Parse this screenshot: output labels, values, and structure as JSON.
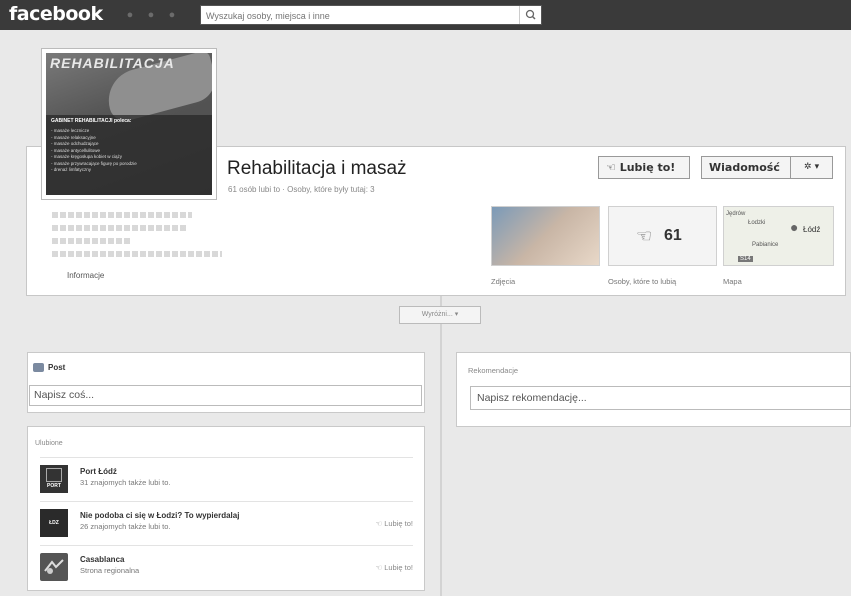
{
  "topbar": {
    "logo": "facebook",
    "search_placeholder": "Wyszukaj osoby, miejsca i inne"
  },
  "profile": {
    "cover_title": "REHABILITACJA",
    "box_header": "GABINET REHABILITACJI poleca:",
    "box_lines": [
      "- masaże lecznicze",
      "- masaże relaksacyjne",
      "- masaże odchudzające",
      "- masaże antycellulitowe",
      "- masaże kręgosłupa kobiet w ciąży",
      "- masaże przywracające figurę po porodzie",
      "- drenaż limfatyczny"
    ],
    "name": "Rehabilitacja i masaż",
    "subtitle": "61 osób lubi to · Osoby, które były tutaj: 3"
  },
  "actions": {
    "like": "Lubię to!",
    "message": "Wiadomość",
    "gear": "✲ ▾"
  },
  "info": {
    "label": "Informacje"
  },
  "tiles": {
    "photos_label": "Zdjęcia",
    "likes_count": "61",
    "likes_label": "Osoby, które to lubią",
    "map_label": "Mapa",
    "map_texts": [
      "Jędrów",
      "Łodzki",
      "Łódź",
      "Pabianice",
      "S14"
    ]
  },
  "timeline": {
    "highlight": "Wyróżni... ▾",
    "post_header": "Post",
    "post_placeholder": "Napisz coś...",
    "rec_header": "Rekomendacje",
    "rec_placeholder": "Napisz rekomendację..."
  },
  "favorites": {
    "header": "Ulubione",
    "items": [
      {
        "name": "Port Łódź",
        "sub": "31 znajomych także lubi to.",
        "thumb": "PORT",
        "like": ""
      },
      {
        "name": "Nie podoba ci się w Łodzi? To wypierdalaj",
        "sub": "26 znajomych także lubi to.",
        "thumb": "ŁDZ",
        "like": "Lubię to!"
      },
      {
        "name": "Casablanca",
        "sub": "Strona regionalna",
        "thumb": "",
        "like": "Lubię to!"
      }
    ]
  },
  "colors": {
    "topbar": "#3a3a3a",
    "background": "#e9e9e9"
  }
}
